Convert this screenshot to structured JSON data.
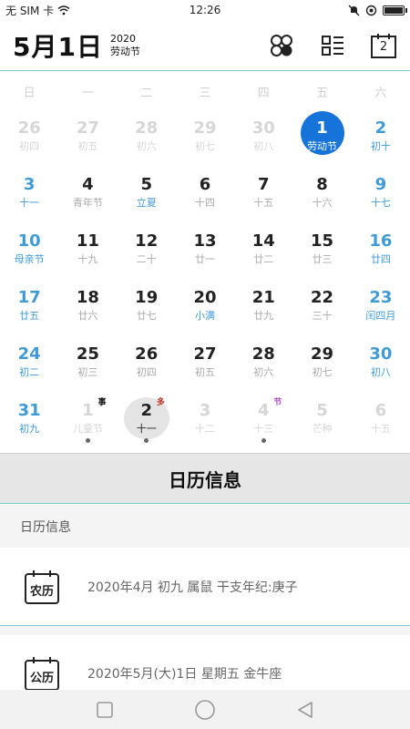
{
  "status": {
    "carrier": "无 SIM 卡",
    "time": "12:26"
  },
  "header": {
    "date": "5月1日",
    "year": "2020",
    "festival": "劳动节",
    "today_badge": "2"
  },
  "weekdays": [
    "日",
    "一",
    "二",
    "三",
    "四",
    "五",
    "六"
  ],
  "days": [
    {
      "n": "26",
      "s": "初四",
      "t": "other"
    },
    {
      "n": "27",
      "s": "初五",
      "t": "other"
    },
    {
      "n": "28",
      "s": "初六",
      "t": "other"
    },
    {
      "n": "29",
      "s": "初七",
      "t": "other"
    },
    {
      "n": "30",
      "s": "初八",
      "t": "other"
    },
    {
      "n": "1",
      "s": "劳动节",
      "t": "selected"
    },
    {
      "n": "2",
      "s": "初十",
      "t": "week"
    },
    {
      "n": "3",
      "s": "十一",
      "t": "week"
    },
    {
      "n": "4",
      "s": "青年节",
      "t": "normal"
    },
    {
      "n": "5",
      "s": "立夏",
      "t": "festival"
    },
    {
      "n": "6",
      "s": "十四",
      "t": "normal"
    },
    {
      "n": "7",
      "s": "十五",
      "t": "normal"
    },
    {
      "n": "8",
      "s": "十六",
      "t": "normal"
    },
    {
      "n": "9",
      "s": "十七",
      "t": "week"
    },
    {
      "n": "10",
      "s": "母亲节",
      "t": "week"
    },
    {
      "n": "11",
      "s": "十九",
      "t": "normal"
    },
    {
      "n": "12",
      "s": "二十",
      "t": "normal"
    },
    {
      "n": "13",
      "s": "廿一",
      "t": "normal"
    },
    {
      "n": "14",
      "s": "廿二",
      "t": "normal"
    },
    {
      "n": "15",
      "s": "廿三",
      "t": "normal"
    },
    {
      "n": "16",
      "s": "廿四",
      "t": "week"
    },
    {
      "n": "17",
      "s": "廿五",
      "t": "week"
    },
    {
      "n": "18",
      "s": "廿六",
      "t": "normal"
    },
    {
      "n": "19",
      "s": "廿七",
      "t": "normal"
    },
    {
      "n": "20",
      "s": "小满",
      "t": "festival"
    },
    {
      "n": "21",
      "s": "廿九",
      "t": "normal"
    },
    {
      "n": "22",
      "s": "三十",
      "t": "normal"
    },
    {
      "n": "23",
      "s": "闰四月",
      "t": "week"
    },
    {
      "n": "24",
      "s": "初二",
      "t": "week"
    },
    {
      "n": "25",
      "s": "初三",
      "t": "normal"
    },
    {
      "n": "26",
      "s": "初四",
      "t": "normal"
    },
    {
      "n": "27",
      "s": "初五",
      "t": "normal"
    },
    {
      "n": "28",
      "s": "初六",
      "t": "normal"
    },
    {
      "n": "29",
      "s": "初七",
      "t": "normal"
    },
    {
      "n": "30",
      "s": "初八",
      "t": "week"
    },
    {
      "n": "31",
      "s": "初九",
      "t": "week"
    },
    {
      "n": "1",
      "s": "儿童节",
      "t": "other",
      "tag": "事",
      "tagColor": "#111",
      "dot": true
    },
    {
      "n": "2",
      "s": "十一",
      "t": "today",
      "tag": "多",
      "tagColor": "#c0392b",
      "dot": true
    },
    {
      "n": "3",
      "s": "十二",
      "t": "other"
    },
    {
      "n": "4",
      "s": "十三",
      "t": "other",
      "tag": "节",
      "tagColor": "#b04fc7",
      "dot": true
    },
    {
      "n": "5",
      "s": "芒种",
      "t": "other"
    },
    {
      "n": "6",
      "s": "十五",
      "t": "other"
    }
  ],
  "section_title": "日历信息",
  "sub_header": "日历信息",
  "lunar": {
    "icon_label": "农历",
    "text": "2020年4月 初九 属鼠 干支年纪:庚子"
  },
  "solar": {
    "icon_label": "公历",
    "text": "2020年5月(大)1日 星期五 金牛座"
  },
  "colors": {
    "accent": "#1673d9",
    "weekend": "#3e9bd8",
    "divider": "#7cc9cf"
  }
}
